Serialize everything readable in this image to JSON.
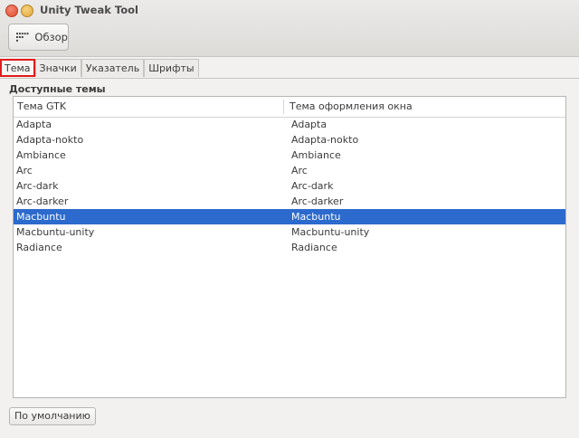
{
  "window": {
    "title": "Unity Tweak Tool"
  },
  "toolbar": {
    "overview_label": "Обзор",
    "overview_icon": "grid-dots-icon"
  },
  "tabs": [
    {
      "label": "Тема",
      "active": true
    },
    {
      "label": "Значки",
      "active": false
    },
    {
      "label": "Указатель",
      "active": false
    },
    {
      "label": "Шрифты",
      "active": false
    }
  ],
  "section": {
    "title": "Доступные темы"
  },
  "table": {
    "columns": [
      "Тема GTK",
      "Тема оформления окна"
    ],
    "rows": [
      {
        "gtk": "Adapta",
        "wm": "Adapta",
        "selected": false
      },
      {
        "gtk": "Adapta-nokto",
        "wm": "Adapta-nokto",
        "selected": false
      },
      {
        "gtk": "Ambiance",
        "wm": "Ambiance",
        "selected": false
      },
      {
        "gtk": "Arc",
        "wm": "Arc",
        "selected": false
      },
      {
        "gtk": "Arc-dark",
        "wm": "Arc-dark",
        "selected": false
      },
      {
        "gtk": "Arc-darker",
        "wm": "Arc-darker",
        "selected": false
      },
      {
        "gtk": "Macbuntu",
        "wm": "Macbuntu",
        "selected": true
      },
      {
        "gtk": "Macbuntu-unity",
        "wm": "Macbuntu-unity",
        "selected": false
      },
      {
        "gtk": "Radiance",
        "wm": "Radiance",
        "selected": false
      }
    ]
  },
  "footer": {
    "default_label": "По умолчанию"
  },
  "colors": {
    "selection": "#2c6acd",
    "highlight_border": "#e01b1b",
    "close_button": "#df4a2d",
    "minimize_button": "#e3a73a"
  }
}
